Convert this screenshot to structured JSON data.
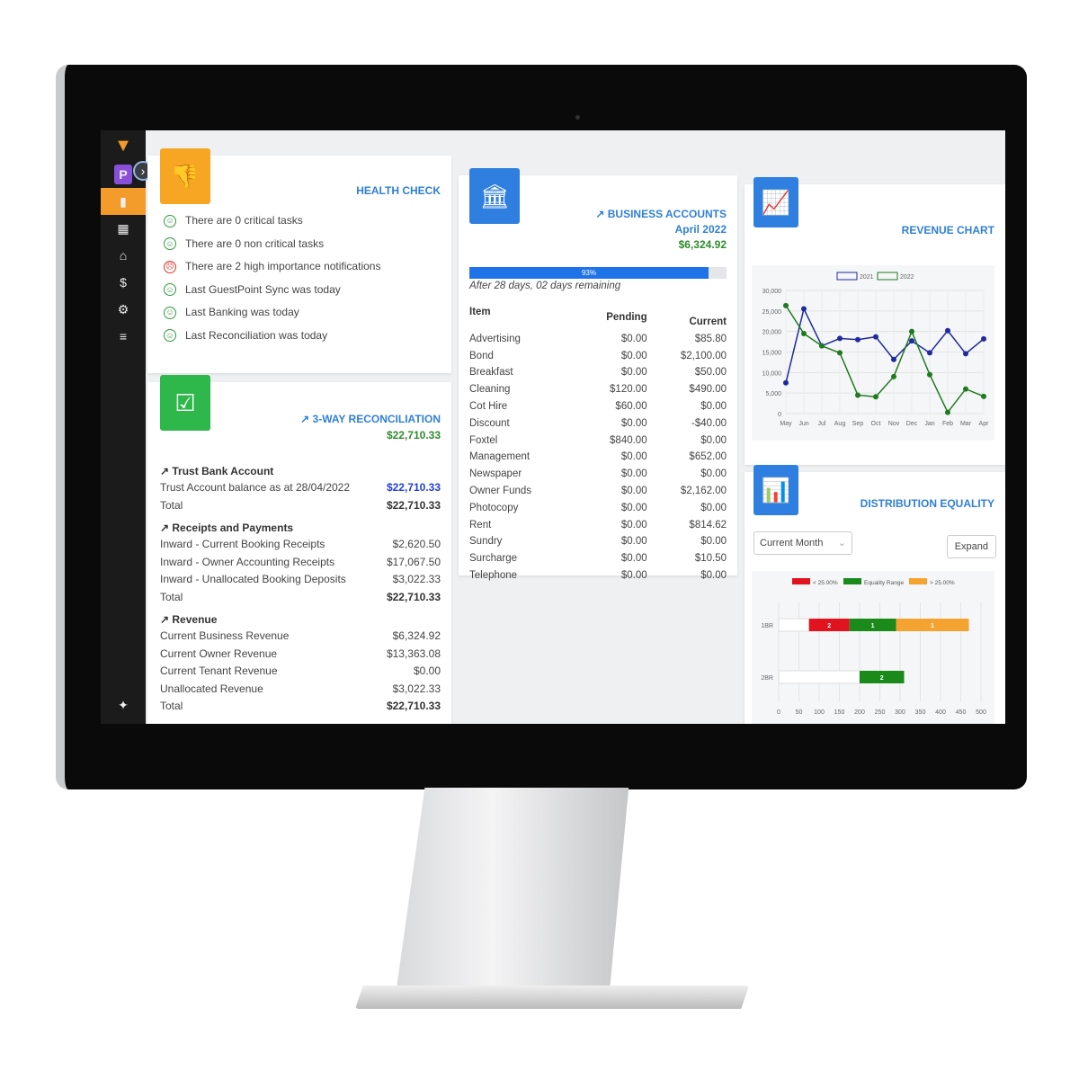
{
  "sidebar": {
    "items": [
      {
        "icon": "logo-triangle-icon",
        "glyph": "▼"
      },
      {
        "icon": "p-badge-icon",
        "glyph": "P"
      },
      {
        "icon": "bar-chart-icon",
        "glyph": "▮"
      },
      {
        "icon": "calendar-icon",
        "glyph": "▦"
      },
      {
        "icon": "home-icon",
        "glyph": "⌂"
      },
      {
        "icon": "dollar-icon",
        "glyph": "$"
      },
      {
        "icon": "user-settings-icon",
        "glyph": "⚙"
      },
      {
        "icon": "document-icon",
        "glyph": "≡"
      },
      {
        "icon": "sparkle-icon",
        "glyph": "✦"
      }
    ],
    "expand_glyph": "›"
  },
  "health": {
    "title": "HEALTH CHECK",
    "items": [
      {
        "text": "There are 0 critical tasks",
        "status": "good"
      },
      {
        "text": "There are 0 non critical tasks",
        "status": "good"
      },
      {
        "text": "There are 2 high importance notifications",
        "status": "bad"
      },
      {
        "text": "Last GuestPoint Sync was today",
        "status": "good"
      },
      {
        "text": "Last Banking was today",
        "status": "good"
      },
      {
        "text": "Last Reconciliation was today",
        "status": "good"
      }
    ]
  },
  "recon": {
    "title": "3-WAY RECONCILIATION",
    "amount": "$22,710.33",
    "trust": {
      "heading": "Trust Bank Account",
      "rows": [
        {
          "label": "Trust Account balance as at 28/04/2022",
          "value": "$22,710.33"
        },
        {
          "label": "Total",
          "value": "$22,710.33"
        }
      ]
    },
    "receipts": {
      "heading": "Receipts and Payments",
      "rows": [
        {
          "label": "Inward - Current Booking Receipts",
          "value": "$2,620.50"
        },
        {
          "label": "Inward - Owner Accounting Receipts",
          "value": "$17,067.50"
        },
        {
          "label": "Inward - Unallocated Booking Deposits",
          "value": "$3,022.33"
        },
        {
          "label": "Total",
          "value": "$22,710.33"
        }
      ]
    },
    "revenue": {
      "heading": "Revenue",
      "rows": [
        {
          "label": "Current Business Revenue",
          "value": "$6,324.92"
        },
        {
          "label": "Current Owner Revenue",
          "value": "$13,363.08"
        },
        {
          "label": "Current Tenant Revenue",
          "value": "$0.00"
        },
        {
          "label": "Unallocated Revenue",
          "value": "$3,022.33"
        },
        {
          "label": "Total",
          "value": "$22,710.33"
        }
      ]
    }
  },
  "business": {
    "title": "BUSINESS ACCOUNTS",
    "period": "April 2022",
    "amount": "$6,324.92",
    "progress": 93,
    "progress_label": "93%",
    "progress_note": "After 28 days, 02 days remaining",
    "columns": [
      "Item",
      "Pending",
      "Current"
    ],
    "rows": [
      [
        "Advertising",
        "$0.00",
        "$85.80"
      ],
      [
        "Bond",
        "$0.00",
        "$2,100.00"
      ],
      [
        "Breakfast",
        "$0.00",
        "$50.00"
      ],
      [
        "Cleaning",
        "$120.00",
        "$490.00"
      ],
      [
        "Cot Hire",
        "$60.00",
        "$0.00"
      ],
      [
        "Discount",
        "$0.00",
        "-$40.00"
      ],
      [
        "Foxtel",
        "$840.00",
        "$0.00"
      ],
      [
        "Management",
        "$0.00",
        "$652.00"
      ],
      [
        "Newspaper",
        "$0.00",
        "$0.00"
      ],
      [
        "Owner Funds",
        "$0.00",
        "$2,162.00"
      ],
      [
        "Photocopy",
        "$0.00",
        "$0.00"
      ],
      [
        "Rent",
        "$0.00",
        "$814.62"
      ],
      [
        "Sundry",
        "$0.00",
        "$0.00"
      ],
      [
        "Surcharge",
        "$0.00",
        "$10.50"
      ],
      [
        "Telephone",
        "$0.00",
        "$0.00"
      ]
    ]
  },
  "revenue_chart": {
    "title": "REVENUE CHART"
  },
  "distribution": {
    "title": "DISTRIBUTION EQUALITY",
    "select_value": "Current Month",
    "expand_label": "Expand"
  },
  "chart_data": [
    {
      "type": "line",
      "x": [
        "May",
        "Jun",
        "Jul",
        "Aug",
        "Sep",
        "Oct",
        "Nov",
        "Dec",
        "Jan",
        "Feb",
        "Mar",
        "Apr"
      ],
      "ylim": [
        0,
        30000
      ],
      "yticks": [
        "0",
        "5,000",
        "10,000",
        "15,000",
        "20,000",
        "25,000",
        "30,000"
      ],
      "grid": true,
      "legend": "top",
      "series": [
        {
          "name": "2021",
          "color": "#1f2a9c",
          "values": [
            7500,
            25500,
            16500,
            18300,
            18000,
            18700,
            13200,
            17700,
            14800,
            20200,
            14600,
            18200
          ]
        },
        {
          "name": "2022",
          "color": "#1f7a1f",
          "values": [
            26300,
            19500,
            16500,
            14800,
            4500,
            4100,
            9000,
            20000,
            9500,
            300,
            6000,
            4200
          ]
        }
      ]
    },
    {
      "type": "bar",
      "orientation": "horizontal",
      "stacked": true,
      "categories": [
        "1BR",
        "2BR"
      ],
      "xlim": [
        0,
        500
      ],
      "xticks": [
        "0",
        "50",
        "100",
        "150",
        "200",
        "250",
        "300",
        "350",
        "400",
        "450",
        "500"
      ],
      "legend": "top",
      "legend_items": [
        {
          "name": "< 25.00%",
          "color": "#e0131f"
        },
        {
          "name": "Equality Range",
          "color": "#1a8a1a"
        },
        {
          "name": "> 25.00%",
          "color": "#f5a330"
        }
      ],
      "segments": [
        {
          "category": "1BR",
          "start": 0,
          "end": 75,
          "color": "#ffffff",
          "label": ""
        },
        {
          "category": "1BR",
          "start": 75,
          "end": 175,
          "color": "#e0131f",
          "label": "2"
        },
        {
          "category": "1BR",
          "start": 175,
          "end": 290,
          "color": "#1a8a1a",
          "label": "1"
        },
        {
          "category": "1BR",
          "start": 290,
          "end": 470,
          "color": "#f5a330",
          "label": "1"
        },
        {
          "category": "2BR",
          "start": 0,
          "end": 200,
          "color": "#ffffff",
          "label": ""
        },
        {
          "category": "2BR",
          "start": 200,
          "end": 310,
          "color": "#1a8a1a",
          "label": "2"
        }
      ]
    }
  ]
}
